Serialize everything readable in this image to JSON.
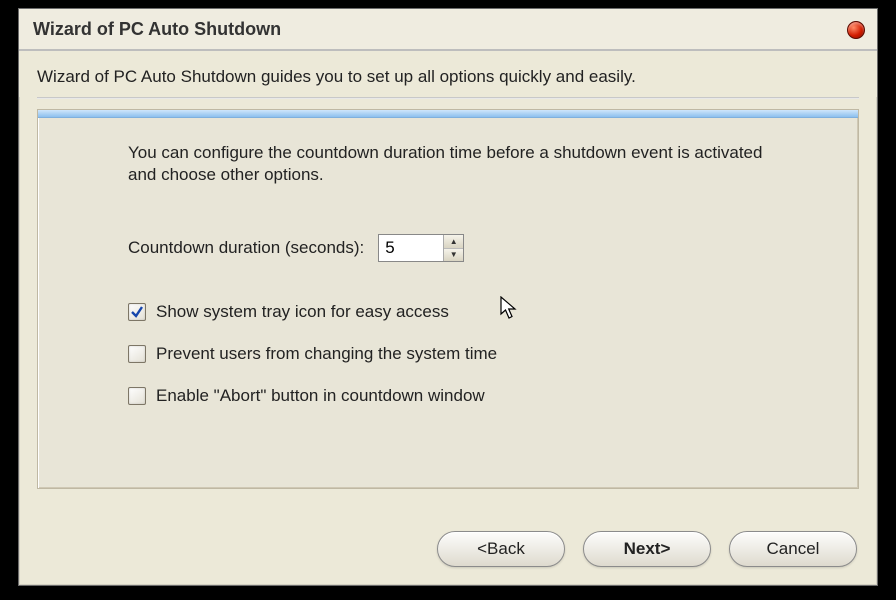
{
  "title": "Wizard of PC Auto Shutdown",
  "subtitle": "Wizard of PC Auto Shutdown guides you to set up all options quickly and easily.",
  "panel": {
    "description": "You can configure the countdown duration time before a shutdown event is activated and choose other options.",
    "countdown_label": "Countdown duration (seconds):",
    "countdown_value": "5",
    "options": {
      "show_tray": {
        "label": "Show system tray icon for easy access",
        "checked": true
      },
      "prevent_time": {
        "label": "Prevent users from changing the system time",
        "checked": false
      },
      "enable_abort": {
        "label": "Enable \"Abort\" button in countdown window",
        "checked": false
      }
    }
  },
  "buttons": {
    "back": "<Back",
    "next": "Next>",
    "cancel": "Cancel"
  }
}
